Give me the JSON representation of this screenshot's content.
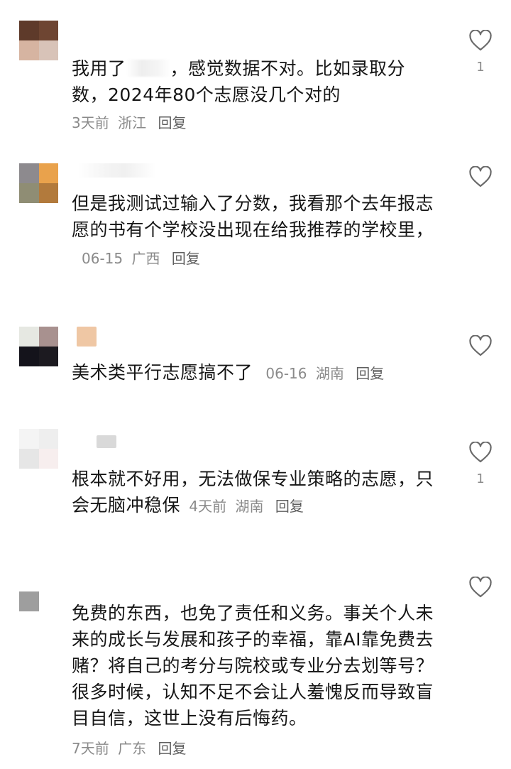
{
  "comments": [
    {
      "text_before": "我用了",
      "text_after": "，感觉数据不对。比如录取分数，2024年80个志愿没几个对的",
      "time": "3天前",
      "location": "浙江",
      "reply": "回复",
      "likes": "1",
      "avatar_colors": [
        "#5e3a2a",
        "#6e4532",
        "#d6b4a1",
        "#d8c3b8"
      ]
    },
    {
      "text": "但是我测试过输入了分数，我看那个去年报志愿的书有个学校没出现在给我推荐的学校里，",
      "time": "06-15",
      "location": "广西",
      "reply": "回复",
      "avatar_colors": [
        "#8d8a8e",
        "#e9a24c",
        "#8f8d74",
        "#b27a3c"
      ]
    },
    {
      "text": "美术类平行志愿搞不了",
      "time": "06-16",
      "location": "湖南",
      "reply": "回复",
      "avatar_colors": [
        "#e6e8e2",
        "#a8918f",
        "#14131b",
        "#1c1a20"
      ]
    },
    {
      "text": "根本就不好用，无法做保专业策略的志愿，只会无脑冲稳保",
      "time": "4天前",
      "location": "湖南",
      "reply": "回复",
      "likes": "1",
      "avatar_colors": [
        "#f4f4f4",
        "#eeeeee",
        "#e6e6e6",
        "#f7eeee"
      ]
    },
    {
      "text": "免费的东西，也免了责任和义务。事关个人未来的成长与发展和孩子的幸福，靠AI靠免费去赌？将自己的考分与院校或专业分去划等号？很多时候，认知不足不会让人羞愧反而导致盲目自信，这世上没有后悔药。",
      "time": "7天前",
      "location": "广东",
      "reply": "回复",
      "avatar_colors": [
        "#9e9e9e"
      ]
    }
  ]
}
